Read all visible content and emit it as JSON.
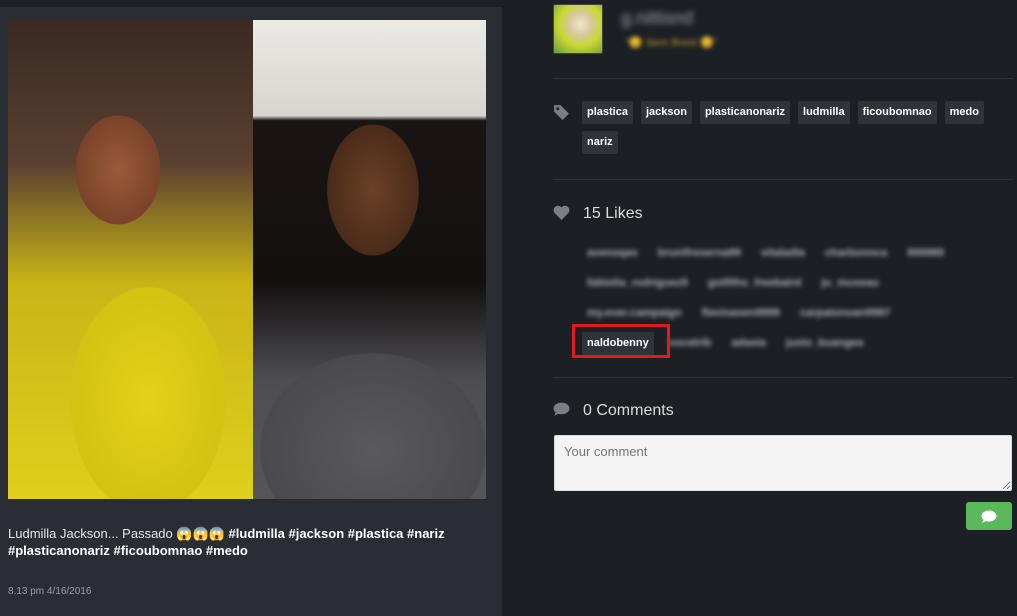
{
  "post": {
    "caption_text": "Ludmilla Jackson... Passado 😱😱😱 ",
    "caption_hashtags": "#ludmilla #jackson #plastica #nariz #plasticanonariz #ficoubomnao #medo",
    "date": "8.13 pm 4/16/2016"
  },
  "profile": {
    "username": "g.nittisnd",
    "subtitle": "\"😊 Sem Brest 😊\""
  },
  "tags": [
    "plastica",
    "jackson",
    "plasticanonariz",
    "ludmilla",
    "ficoubomnao",
    "medo",
    "nariz"
  ],
  "likes": {
    "label": "15 Likes",
    "rows": [
      [
        "avenoqas",
        "brunifreserna99",
        "vitaladla",
        "charbonnca",
        "899989"
      ],
      [
        "fabiolia_rodriguez9",
        "gotfilho_freebaird",
        "ju_museau"
      ],
      [
        "my.ever.campaign",
        "flavinasen9999",
        "carpatonoan9987"
      ],
      [
        "naldobenny",
        "vocetrib",
        "adasia",
        "justo_buangea"
      ]
    ]
  },
  "comments": {
    "label": "0 Comments",
    "placeholder": "Your comment"
  },
  "icons": {
    "tag": "tag-icon",
    "heart": "heart-icon",
    "comment": "comment-bubble-icon",
    "send": "send-comment-icon"
  },
  "colors": {
    "highlight": "#e11b1b",
    "send_button": "#5cb85c"
  }
}
